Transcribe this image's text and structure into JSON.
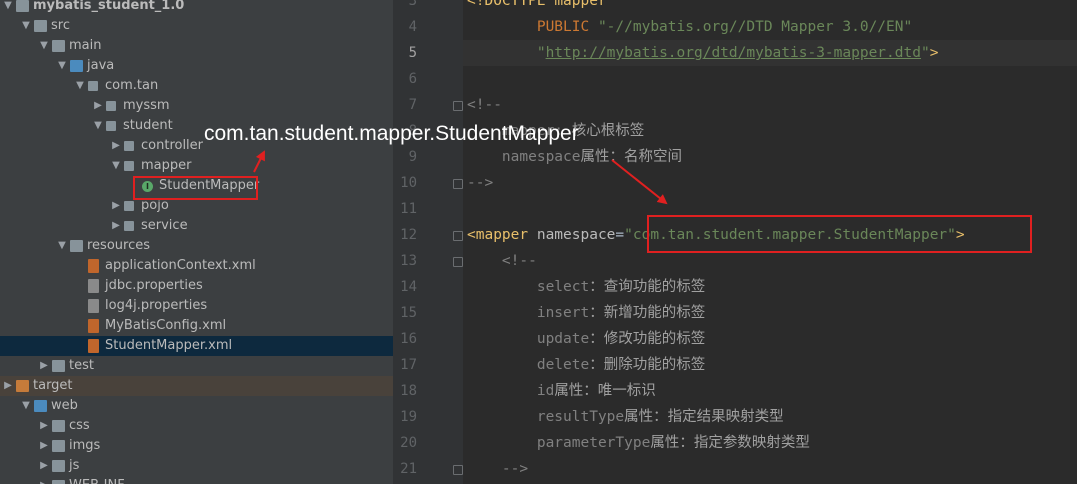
{
  "project_tree": {
    "rows": [
      {
        "label": "mybatis_student_1.0",
        "icon": "module-folder-icon",
        "expanded": true
      },
      {
        "label": "src",
        "icon": "folder-icon",
        "expanded": true
      },
      {
        "label": "main",
        "icon": "folder-icon",
        "expanded": true
      },
      {
        "label": "java",
        "icon": "source-root-folder-icon",
        "expanded": true
      },
      {
        "label": "com.tan",
        "icon": "package-icon",
        "expanded": true
      },
      {
        "label": "myssm",
        "icon": "package-icon",
        "expanded": false
      },
      {
        "label": "student",
        "icon": "package-icon",
        "expanded": true
      },
      {
        "label": "controller",
        "icon": "package-icon",
        "expanded": false
      },
      {
        "label": "mapper",
        "icon": "package-icon",
        "expanded": true
      },
      {
        "label": "StudentMapper",
        "icon": "interface-icon",
        "expanded": null
      },
      {
        "label": "pojo",
        "icon": "package-icon",
        "expanded": false
      },
      {
        "label": "service",
        "icon": "package-icon",
        "expanded": false
      },
      {
        "label": "resources",
        "icon": "resources-folder-icon",
        "expanded": true
      },
      {
        "label": "applicationContext.xml",
        "icon": "xml-file-icon",
        "expanded": null
      },
      {
        "label": "jdbc.properties",
        "icon": "properties-file-icon",
        "expanded": null
      },
      {
        "label": "log4j.properties",
        "icon": "properties-file-icon",
        "expanded": null
      },
      {
        "label": "MyBatisConfig.xml",
        "icon": "xml-file-icon",
        "expanded": null
      },
      {
        "label": "StudentMapper.xml",
        "icon": "xml-file-icon",
        "expanded": null,
        "selected": true
      },
      {
        "label": "test",
        "icon": "folder-icon",
        "expanded": false
      },
      {
        "label": "target",
        "icon": "excluded-folder-icon",
        "expanded": false
      },
      {
        "label": "web",
        "icon": "web-folder-icon",
        "expanded": true
      },
      {
        "label": "css",
        "icon": "folder-icon",
        "expanded": false
      },
      {
        "label": "imgs",
        "icon": "folder-icon",
        "expanded": false
      },
      {
        "label": "js",
        "icon": "folder-icon",
        "expanded": false
      },
      {
        "label": "WEB-INF",
        "icon": "folder-icon",
        "expanded": false
      }
    ]
  },
  "annotation": {
    "text": "com.tan.student.mapper.StudentMapper",
    "color": "#e02020"
  },
  "editor": {
    "current_line": 5,
    "lines": [
      {
        "n": 3,
        "parts": [
          [
            "c-tag",
            "<!DOCTYPE "
          ],
          [
            "c-tag",
            "mapper"
          ]
        ]
      },
      {
        "n": 4,
        "parts": [
          [
            "c-plain",
            "        "
          ],
          [
            "c-kw",
            "PUBLIC "
          ],
          [
            "c-str",
            "\"-//mybatis.org//DTD Mapper 3.0//EN\""
          ]
        ]
      },
      {
        "n": 5,
        "parts": [
          [
            "c-plain",
            "        "
          ],
          [
            "c-str",
            "\""
          ],
          [
            "c-url",
            "http://mybatis.org/dtd/mybatis-3-mapper.dtd"
          ],
          [
            "c-str",
            "\""
          ],
          [
            "c-tag",
            ">"
          ]
        ]
      },
      {
        "n": 6,
        "parts": []
      },
      {
        "n": 7,
        "parts": [
          [
            "c-com",
            "<!--"
          ]
        ]
      },
      {
        "n": 8,
        "parts": [
          [
            "c-com",
            "    mapper: "
          ],
          [
            "c-cn",
            "核心根标签"
          ]
        ]
      },
      {
        "n": 9,
        "parts": [
          [
            "c-com",
            "    namespace"
          ],
          [
            "c-cn",
            "属性：名称空间"
          ]
        ]
      },
      {
        "n": 10,
        "parts": [
          [
            "c-com",
            "-->"
          ]
        ]
      },
      {
        "n": 11,
        "parts": []
      },
      {
        "n": 12,
        "parts": [
          [
            "c-tag",
            "<mapper "
          ],
          [
            "c-attr",
            "namespace"
          ],
          [
            "c-plain",
            "="
          ],
          [
            "c-str",
            "\"com.tan.student.mapper.StudentMapper\""
          ],
          [
            "c-tag",
            ">"
          ]
        ]
      },
      {
        "n": 13,
        "parts": [
          [
            "c-com",
            "    <!--"
          ]
        ]
      },
      {
        "n": 14,
        "parts": [
          [
            "c-com",
            "        select"
          ],
          [
            "c-cn",
            "：查询功能的标签"
          ]
        ]
      },
      {
        "n": 15,
        "parts": [
          [
            "c-com",
            "        insert"
          ],
          [
            "c-cn",
            "：新增功能的标签"
          ]
        ]
      },
      {
        "n": 16,
        "parts": [
          [
            "c-com",
            "        update"
          ],
          [
            "c-cn",
            "：修改功能的标签"
          ]
        ]
      },
      {
        "n": 17,
        "parts": [
          [
            "c-com",
            "        delete"
          ],
          [
            "c-cn",
            "：删除功能的标签"
          ]
        ]
      },
      {
        "n": 18,
        "parts": [
          [
            "c-com",
            "        id"
          ],
          [
            "c-cn",
            "属性：唯一标识"
          ]
        ]
      },
      {
        "n": 19,
        "parts": [
          [
            "c-com",
            "        resultType"
          ],
          [
            "c-cn",
            "属性：指定结果映射类型"
          ]
        ]
      },
      {
        "n": 20,
        "parts": [
          [
            "c-com",
            "        parameterType"
          ],
          [
            "c-cn",
            "属性：指定参数映射类型"
          ]
        ]
      },
      {
        "n": 21,
        "parts": [
          [
            "c-com",
            "    -->"
          ]
        ]
      }
    ]
  }
}
